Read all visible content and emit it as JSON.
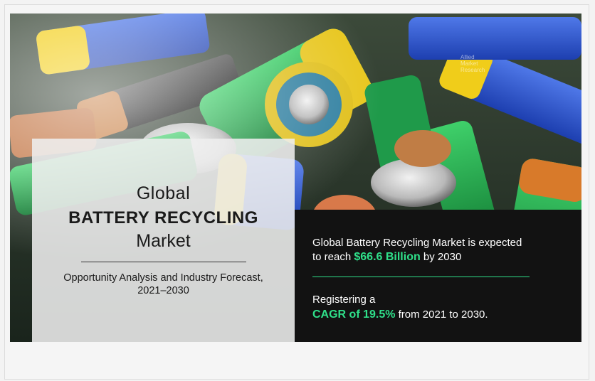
{
  "watermark": {
    "lines": [
      "Allied",
      "Market",
      "Research"
    ]
  },
  "left_panel": {
    "global": "Global",
    "title": "BATTERY RECYCLING",
    "market": "Market",
    "subtitle_line1": "Opportunity Analysis and Industry Forecast,",
    "subtitle_line2": "2021–2030"
  },
  "right_panel": {
    "line1": "Global Battery Recycling Market is expected",
    "line2_prefix": "to reach ",
    "line2_value": "$66.6 Billion",
    "line2_suffix": " by 2030",
    "line3": "Registering a",
    "line4_value": "CAGR of 19.5%",
    "line4_suffix": " from 2021 to 2030."
  },
  "colors": {
    "accent": "#2fe08a",
    "dark_panel": "#121212",
    "light_panel": "#eeeeee"
  }
}
